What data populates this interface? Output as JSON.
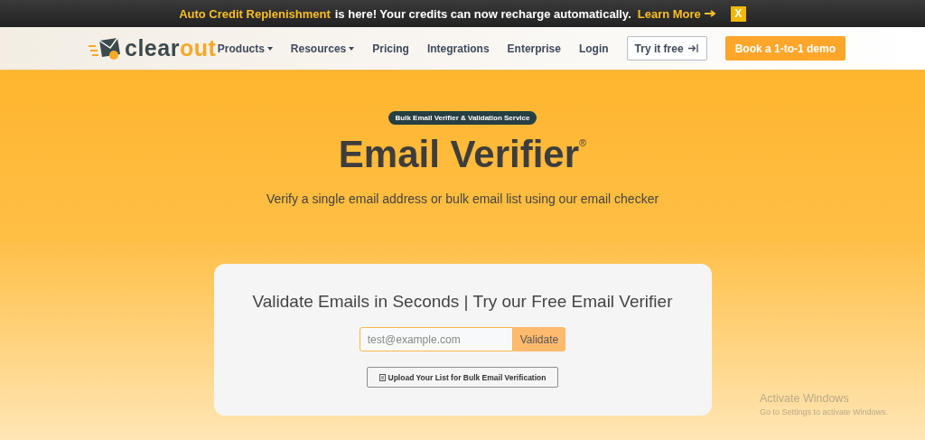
{
  "announcement": {
    "highlight": "Auto Credit Replenishment",
    "text": "is here! Your credits can now recharge automatically.",
    "link": "Learn More",
    "close": "X"
  },
  "logo": {
    "dark": "clear",
    "accent": "out"
  },
  "nav": [
    {
      "label": "Products",
      "dropdown": true
    },
    {
      "label": "Resources",
      "dropdown": true
    },
    {
      "label": "Pricing",
      "dropdown": false
    },
    {
      "label": "Integrations",
      "dropdown": false
    },
    {
      "label": "Enterprise",
      "dropdown": false
    },
    {
      "label": "Login",
      "dropdown": false
    }
  ],
  "actions": [
    {
      "label": "Try it free",
      "kind": "outline"
    },
    {
      "label": "Book a 1-to-1 demo",
      "kind": "filled"
    }
  ],
  "hero": {
    "badge": "Bulk Email Verifier & Validation Service",
    "title": "Email Verifier$^{®}$",
    "subtitle": "Verify a single email address or bulk email list using our email checker"
  },
  "card": {
    "heading": "Validate Emails in Seconds | Try our Free Email Verifier",
    "email": {
      "placeholder": "test@example.com"
    },
    "validate": "Validate",
    "upload": "Upload Your List for Bulk Email Verification"
  },
  "os_notice": {
    "title": "Activate Windows",
    "text": "Go to Settings to activate Windows."
  }
}
